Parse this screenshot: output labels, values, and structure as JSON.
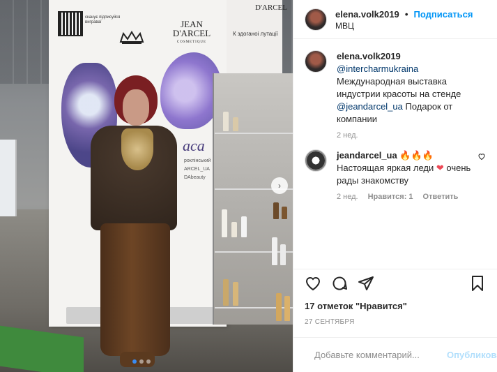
{
  "photo": {
    "qr_caption": "сканує підписуйся виграваї",
    "brand_main": "JEAN D'ARCEL",
    "brand_sub": "COSMETIQUE",
    "brand_secondary": "D'ARCEL",
    "banner_script": "aca",
    "banner_small_text_1": "роклінський",
    "banner_small_text_2": "ARCEL_UA",
    "banner_small_text_3": "DAbeauty",
    "banner2_text": "К здоганоі лутації",
    "slide_count": 3,
    "active_slide": 1
  },
  "header": {
    "username": "elena.volk2019",
    "separator": "•",
    "follow_label": "Подписаться",
    "location": "МВЦ"
  },
  "caption": {
    "username": "elena.volk2019",
    "mention1": "@intercharmukraina",
    "text1": " Международная выставка индустрии красоты на стенде ",
    "mention2": "@jeandarcel_ua",
    "text2": " Подарок от компании",
    "time": "2 нед."
  },
  "comments": [
    {
      "username": "jeandarcel_ua",
      "emojis": "🔥🔥🔥",
      "text1": " Настоящая яркая леди ",
      "heart": "❤",
      "text2": " очень рады знакомству",
      "time": "2 нед.",
      "likes": "Нравится: 1",
      "reply": "Ответить"
    }
  ],
  "likes_text": "17 отметок \"Нравится\"",
  "date_text": "27 СЕНТЯБРЯ",
  "add_comment": {
    "placeholder": "Добавьте комментарий...",
    "publish_label": "Опубликовать"
  },
  "colors": {
    "accent": "#0095f6",
    "mention": "#00376b",
    "like_red": "#ed4956"
  }
}
